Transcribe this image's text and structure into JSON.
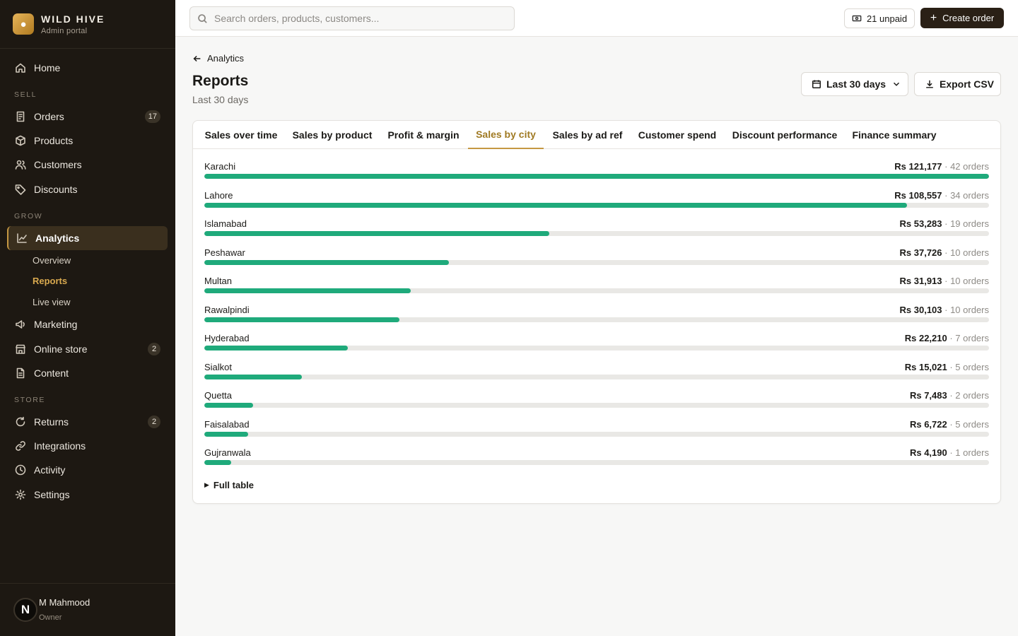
{
  "brand": {
    "name": "WILD HIVE",
    "subtitle": "Admin portal"
  },
  "nav": {
    "home": "Home",
    "section_sell": "SELL",
    "orders": {
      "label": "Orders",
      "badge": "17"
    },
    "products": "Products",
    "customers": "Customers",
    "discounts": "Discounts",
    "section_grow": "GROW",
    "analytics": "Analytics",
    "analytics_sub": [
      "Overview",
      "Reports",
      "Live view"
    ],
    "marketing": "Marketing",
    "online_store": {
      "label": "Online store",
      "badge": "2"
    },
    "content": "Content",
    "section_store": "STORE",
    "returns": {
      "label": "Returns",
      "badge": "2"
    },
    "integrations": "Integrations",
    "activity": "Activity",
    "settings": "Settings"
  },
  "user": {
    "initial": "N",
    "name": "M Mahmood",
    "role": "Owner"
  },
  "topbar": {
    "search_placeholder": "Search orders, products, customers...",
    "unpaid_label": "21 unpaid",
    "create_label": "Create order"
  },
  "header": {
    "back_label": "Analytics",
    "title": "Reports",
    "subtitle": "Last 30 days",
    "range_label": "Last 30 days",
    "export_label": "Export CSV"
  },
  "tabs": [
    "Sales over time",
    "Sales by product",
    "Profit & margin",
    "Sales by city",
    "Sales by ad ref",
    "Customer spend",
    "Discount performance",
    "Finance summary"
  ],
  "active_tab": "Sales by city",
  "colors": {
    "bar_fill": "#1faa7b",
    "accent": "#c59842",
    "sidebar_bg": "#1d1812"
  },
  "chart_data": {
    "type": "bar",
    "orientation": "horizontal",
    "currency": "Rs",
    "categories": [
      "Karachi",
      "Lahore",
      "Islamabad",
      "Peshawar",
      "Multan",
      "Rawalpindi",
      "Hyderabad",
      "Sialkot",
      "Quetta",
      "Faisalabad",
      "Gujranwala"
    ],
    "values": [
      121177,
      108557,
      53283,
      37726,
      31913,
      30103,
      22210,
      15021,
      7483,
      6722,
      4190
    ],
    "value_labels": [
      "Rs 121,177",
      "Rs 108,557",
      "Rs 53,283",
      "Rs 37,726",
      "Rs 31,913",
      "Rs 30,103",
      "Rs 22,210",
      "Rs 15,021",
      "Rs 7,483",
      "Rs 6,722",
      "Rs 4,190"
    ],
    "orders": [
      "42 orders",
      "34 orders",
      "19 orders",
      "10 orders",
      "10 orders",
      "10 orders",
      "7 orders",
      "5 orders",
      "2 orders",
      "5 orders",
      "1 orders"
    ],
    "max": 121177
  },
  "full_table_label": "Full table"
}
